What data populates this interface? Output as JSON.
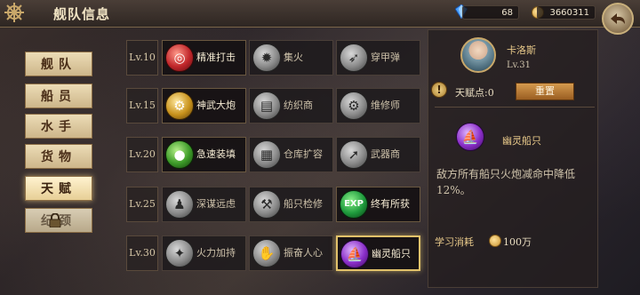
{
  "header": {
    "title": "舰队信息",
    "gems": "68",
    "gold": "3660311"
  },
  "menu": [
    {
      "label": "舰队",
      "state": "normal"
    },
    {
      "label": "船员",
      "state": "normal"
    },
    {
      "label": "水手",
      "state": "normal"
    },
    {
      "label": "货物",
      "state": "normal"
    },
    {
      "label": "天赋",
      "state": "active"
    },
    {
      "label": "纪颈",
      "state": "locked"
    }
  ],
  "talents": [
    {
      "level": "Lv.10",
      "items": [
        {
          "label": "精准打击",
          "icon": "target-icon",
          "color": "red",
          "on": true
        },
        {
          "label": "集火",
          "icon": "burst-icon",
          "color": "gray",
          "on": false
        },
        {
          "label": "穿甲弹",
          "icon": "shell-icon",
          "color": "gray",
          "on": false
        }
      ]
    },
    {
      "level": "Lv.15",
      "items": [
        {
          "label": "神武大炮",
          "icon": "cannon-icon",
          "color": "gold",
          "on": true
        },
        {
          "label": "纺织商",
          "icon": "cloth-icon",
          "color": "gray",
          "on": false
        },
        {
          "label": "维修师",
          "icon": "gear-icon",
          "color": "gray",
          "on": false
        }
      ]
    },
    {
      "level": "Lv.20",
      "items": [
        {
          "label": "急速装填",
          "icon": "cannonballs-icon",
          "color": "green",
          "on": true
        },
        {
          "label": "仓库扩容",
          "icon": "crates-icon",
          "color": "gray",
          "on": false
        },
        {
          "label": "武器商",
          "icon": "musket-icon",
          "color": "gray",
          "on": false
        }
      ]
    },
    {
      "level": "Lv.25",
      "items": [
        {
          "label": "深谋远虑",
          "icon": "strategist-icon",
          "color": "gray",
          "on": false
        },
        {
          "label": "船只检修",
          "icon": "ship-repair-icon",
          "color": "gray",
          "on": false
        },
        {
          "label": "终有所获",
          "icon": "exp-icon",
          "color": "exp",
          "on": true
        }
      ]
    },
    {
      "level": "Lv.30",
      "items": [
        {
          "label": "火力加持",
          "icon": "fire-icon",
          "color": "gray",
          "on": false
        },
        {
          "label": "振奋人心",
          "icon": "cheer-icon",
          "color": "gray",
          "on": false
        },
        {
          "label": "幽灵船只",
          "icon": "ghost-ship-icon",
          "color": "purple",
          "on": true,
          "selected": true
        }
      ]
    }
  ],
  "captain": {
    "name": "卡洛斯",
    "level": "Lv.31"
  },
  "talent_points": "天赋点:0",
  "reset_label": "重置",
  "selected": {
    "name": "幽灵船只",
    "description": "敌方所有船只火炮减命中降低12%。",
    "cost_label": "学习消耗",
    "cost_value": "100万"
  }
}
